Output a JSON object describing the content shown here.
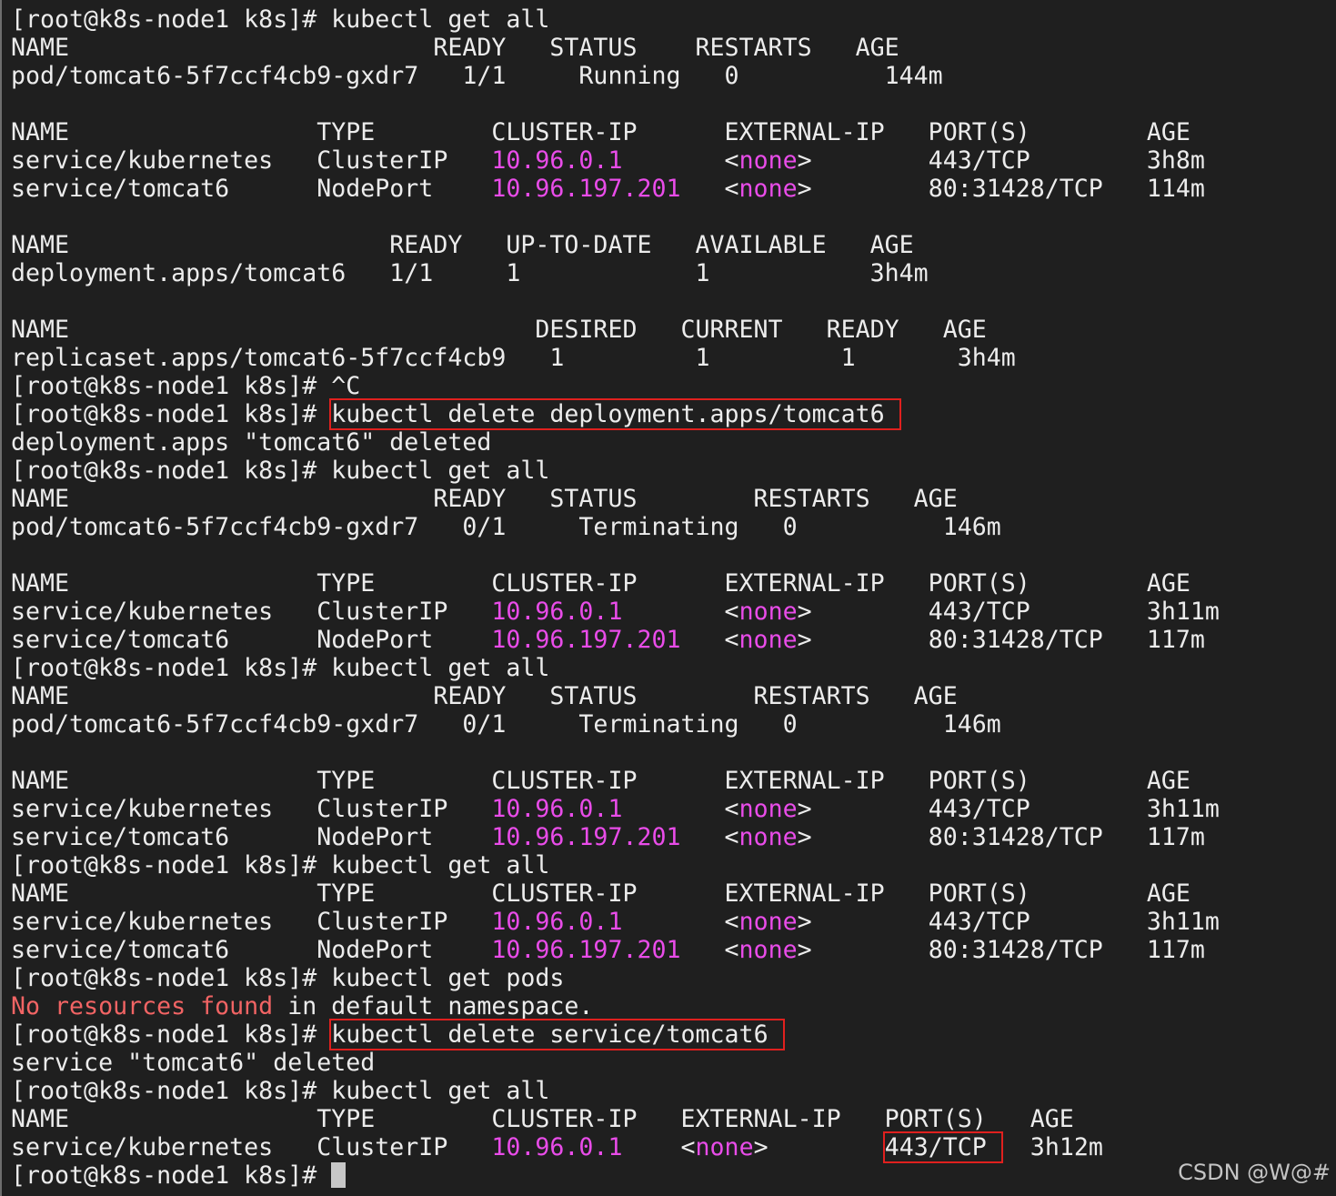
{
  "terminal": {
    "lines": [
      [
        {
          "text": "[root@k8s-node1 k8s]# kubectl get all"
        }
      ],
      [
        {
          "text": "NAME                         READY   STATUS    RESTARTS   AGE"
        }
      ],
      [
        {
          "text": "pod/tomcat6-5f7ccf4cb9-gxdr7   1/1     Running   0          144m"
        }
      ],
      [
        {
          "text": ""
        }
      ],
      [
        {
          "text": "NAME                 TYPE        CLUSTER-IP      EXTERNAL-IP   PORT(S)        AGE"
        }
      ],
      [
        {
          "text": "service/kubernetes   ClusterIP   "
        },
        {
          "text": "10.96.0.1",
          "style": "magenta"
        },
        {
          "text": "       <"
        },
        {
          "text": "none",
          "style": "magenta"
        },
        {
          "text": ">        443/TCP        3h8m"
        }
      ],
      [
        {
          "text": "service/tomcat6      NodePort    "
        },
        {
          "text": "10.96.197.201",
          "style": "magenta"
        },
        {
          "text": "   <"
        },
        {
          "text": "none",
          "style": "magenta"
        },
        {
          "text": ">        80:31428/TCP   114m"
        }
      ],
      [
        {
          "text": ""
        }
      ],
      [
        {
          "text": "NAME                      READY   UP-TO-DATE   AVAILABLE   AGE"
        }
      ],
      [
        {
          "text": "deployment.apps/tomcat6   1/1     1            1           3h4m"
        }
      ],
      [
        {
          "text": ""
        }
      ],
      [
        {
          "text": "NAME                                DESIRED   CURRENT   READY   AGE"
        }
      ],
      [
        {
          "text": "replicaset.apps/tomcat6-5f7ccf4cb9   1         1         1       3h4m"
        }
      ],
      [
        {
          "text": "[root@k8s-node1 k8s]# ^C"
        }
      ],
      [
        {
          "text": "[root@k8s-node1 k8s]# "
        },
        {
          "text": "kubectl delete deployment.apps/tomcat6 ",
          "style": "hl"
        }
      ],
      [
        {
          "text": "deployment.apps \"tomcat6\" deleted"
        }
      ],
      [
        {
          "text": "[root@k8s-node1 k8s]# kubectl get all"
        }
      ],
      [
        {
          "text": "NAME                         READY   STATUS        RESTARTS   AGE"
        }
      ],
      [
        {
          "text": "pod/tomcat6-5f7ccf4cb9-gxdr7   0/1     Terminating   0          146m"
        }
      ],
      [
        {
          "text": ""
        }
      ],
      [
        {
          "text": "NAME                 TYPE        CLUSTER-IP      EXTERNAL-IP   PORT(S)        AGE"
        }
      ],
      [
        {
          "text": "service/kubernetes   ClusterIP   "
        },
        {
          "text": "10.96.0.1",
          "style": "magenta"
        },
        {
          "text": "       <"
        },
        {
          "text": "none",
          "style": "magenta"
        },
        {
          "text": ">        443/TCP        3h11m"
        }
      ],
      [
        {
          "text": "service/tomcat6      NodePort    "
        },
        {
          "text": "10.96.197.201",
          "style": "magenta"
        },
        {
          "text": "   <"
        },
        {
          "text": "none",
          "style": "magenta"
        },
        {
          "text": ">        80:31428/TCP   117m"
        }
      ],
      [
        {
          "text": "[root@k8s-node1 k8s]# kubectl get all"
        }
      ],
      [
        {
          "text": "NAME                         READY   STATUS        RESTARTS   AGE"
        }
      ],
      [
        {
          "text": "pod/tomcat6-5f7ccf4cb9-gxdr7   0/1     Terminating   0          146m"
        }
      ],
      [
        {
          "text": ""
        }
      ],
      [
        {
          "text": "NAME                 TYPE        CLUSTER-IP      EXTERNAL-IP   PORT(S)        AGE"
        }
      ],
      [
        {
          "text": "service/kubernetes   ClusterIP   "
        },
        {
          "text": "10.96.0.1",
          "style": "magenta"
        },
        {
          "text": "       <"
        },
        {
          "text": "none",
          "style": "magenta"
        },
        {
          "text": ">        443/TCP        3h11m"
        }
      ],
      [
        {
          "text": "service/tomcat6      NodePort    "
        },
        {
          "text": "10.96.197.201",
          "style": "magenta"
        },
        {
          "text": "   <"
        },
        {
          "text": "none",
          "style": "magenta"
        },
        {
          "text": ">        80:31428/TCP   117m"
        }
      ],
      [
        {
          "text": "[root@k8s-node1 k8s]# kubectl get all"
        }
      ],
      [
        {
          "text": "NAME                 TYPE        CLUSTER-IP      EXTERNAL-IP   PORT(S)        AGE"
        }
      ],
      [
        {
          "text": "service/kubernetes   ClusterIP   "
        },
        {
          "text": "10.96.0.1",
          "style": "magenta"
        },
        {
          "text": "       <"
        },
        {
          "text": "none",
          "style": "magenta"
        },
        {
          "text": ">        443/TCP        3h11m"
        }
      ],
      [
        {
          "text": "service/tomcat6      NodePort    "
        },
        {
          "text": "10.96.197.201",
          "style": "magenta"
        },
        {
          "text": "   <"
        },
        {
          "text": "none",
          "style": "magenta"
        },
        {
          "text": ">        80:31428/TCP   117m"
        }
      ],
      [
        {
          "text": "[root@k8s-node1 k8s]# kubectl get pods"
        }
      ],
      [
        {
          "text": "No resources found",
          "style": "red"
        },
        {
          "text": " in default namespace."
        }
      ],
      [
        {
          "text": "[root@k8s-node1 k8s]# "
        },
        {
          "text": "kubectl delete service/tomcat6 ",
          "style": "hl"
        }
      ],
      [
        {
          "text": "service \"tomcat6\" deleted"
        }
      ],
      [
        {
          "text": "[root@k8s-node1 k8s]# kubectl get all"
        }
      ],
      [
        {
          "text": "NAME                 TYPE        CLUSTER-IP   EXTERNAL-IP   PORT(S)   AGE"
        }
      ],
      [
        {
          "text": "service/kubernetes   ClusterIP   "
        },
        {
          "text": "10.96.0.1",
          "style": "magenta"
        },
        {
          "text": "    <"
        },
        {
          "text": "none",
          "style": "magenta"
        },
        {
          "text": ">        "
        },
        {
          "text": "443/TCP ",
          "style": "hl"
        },
        {
          "text": "  3h12m"
        }
      ],
      [
        {
          "text": "[root@k8s-node1 k8s]# "
        },
        {
          "cursor": true
        }
      ]
    ]
  },
  "colors": {
    "background": "#1f1f1f",
    "foreground": "#ececec",
    "ip_magenta": "#e94ce9",
    "error_red": "#f26464",
    "highlight_box": "#e0201e",
    "cursor": "#c7c7c7"
  },
  "watermark": "CSDN @W@#"
}
